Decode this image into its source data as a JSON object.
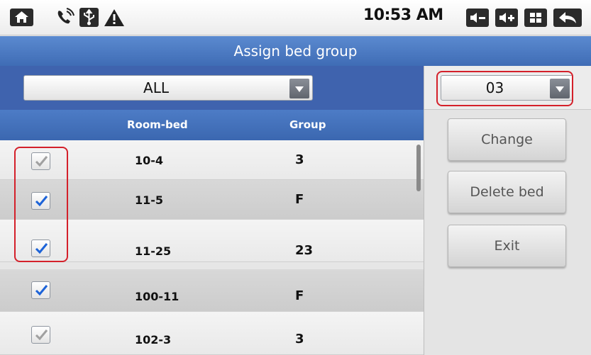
{
  "status_bar": {
    "time": "10:53 AM",
    "left_icons": [
      "home-icon",
      "phone-icon",
      "usb-icon",
      "warning-icon"
    ],
    "right_icons": [
      "volume-down-icon",
      "volume-up-icon",
      "menu-grid-icon",
      "back-icon"
    ]
  },
  "title": "Assign bed group",
  "filter": {
    "selected": "ALL"
  },
  "group_select": {
    "selected": "03"
  },
  "table": {
    "columns": [
      "Room-bed",
      "Group"
    ],
    "rows": [
      {
        "checked": true,
        "active": false,
        "room_bed": "10-4",
        "group": "3"
      },
      {
        "checked": true,
        "active": true,
        "room_bed": "11-5",
        "group": "F"
      },
      {
        "checked": true,
        "active": true,
        "room_bed": "11-25",
        "group": "23"
      },
      {
        "checked": true,
        "active": true,
        "room_bed": "100-11",
        "group": "F"
      },
      {
        "checked": true,
        "active": false,
        "room_bed": "102-3",
        "group": "3"
      }
    ]
  },
  "buttons": {
    "change": "Change",
    "delete_bed": "Delete bed",
    "exit": "Exit"
  },
  "colors": {
    "title_bar": "#4a79c4",
    "header": "#3f63ae",
    "check_active": "#1c63d8",
    "check_inactive": "#9a9a9a",
    "highlight": "#d4202a"
  }
}
